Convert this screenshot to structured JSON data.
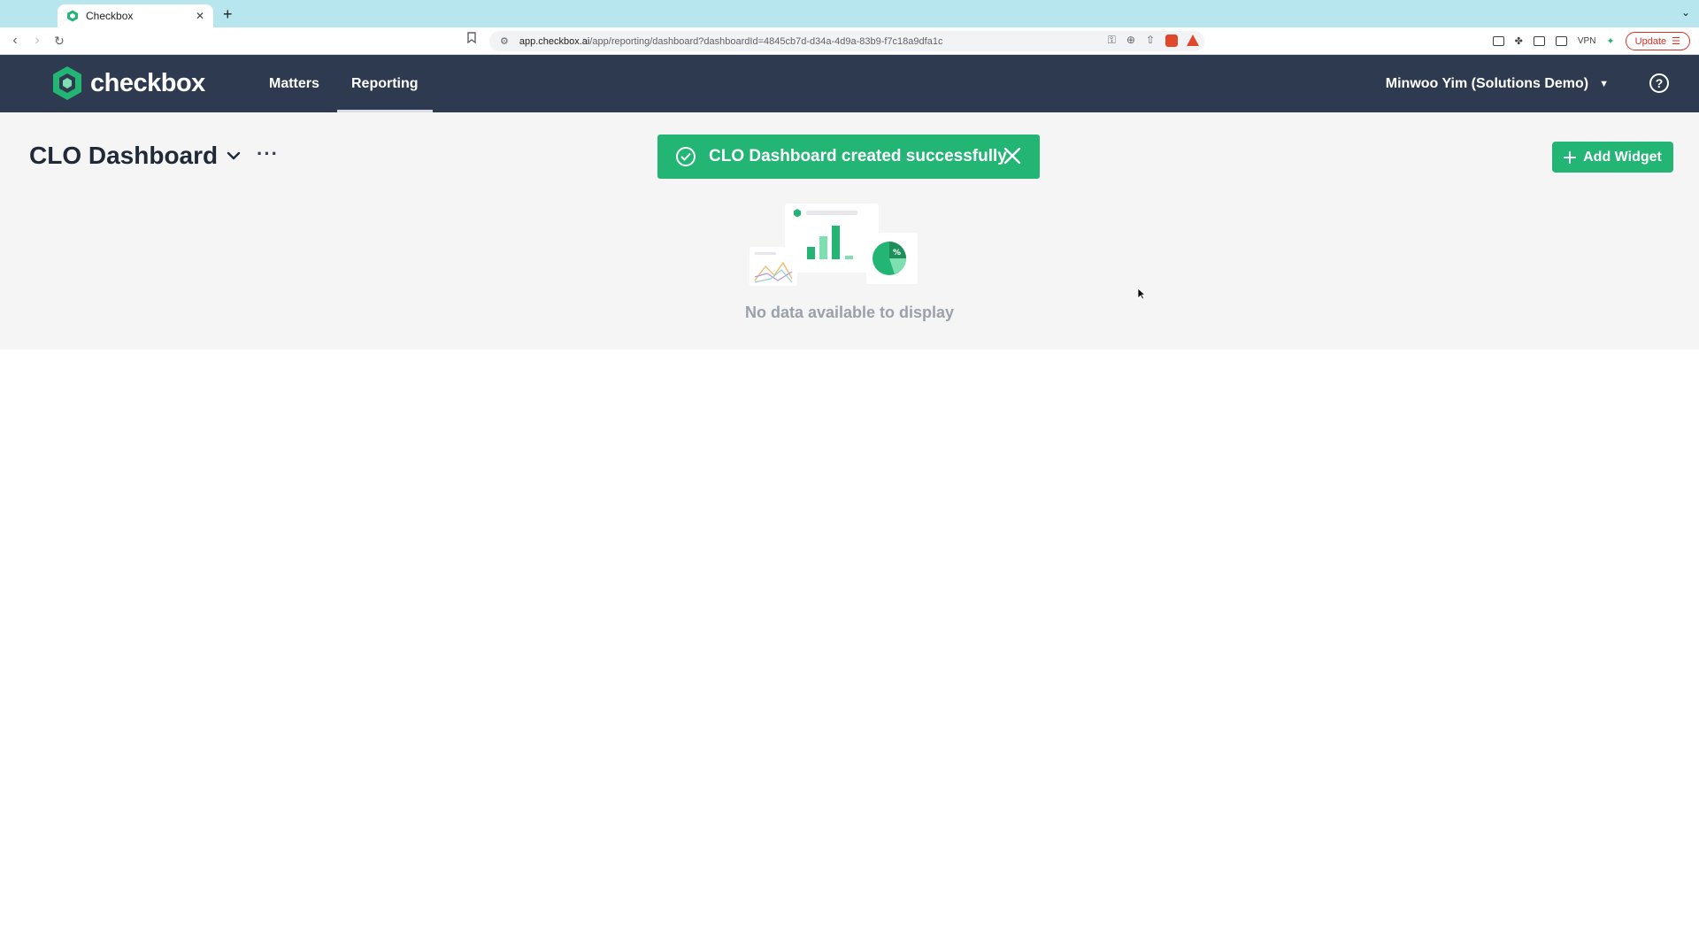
{
  "browser": {
    "tab_title": "Checkbox",
    "url_domain": "app.checkbox.ai",
    "url_path": "/app/reporting/dashboard?dashboardId=4845cb7d-d34a-4d9a-83b9-f7c18a9dfa1c",
    "vpn_label": "VPN",
    "update_label": "Update"
  },
  "app": {
    "logo_text": "checkbox",
    "nav": [
      {
        "label": "Matters"
      },
      {
        "label": "Reporting"
      }
    ],
    "user_name": "Minwoo Yim (Solutions Demo)",
    "help_label": "?"
  },
  "dashboard": {
    "title": "CLO Dashboard",
    "more_label": "···",
    "toast_message": "CLO Dashboard created successfully",
    "add_widget_label": "Add Widget",
    "empty_message": "No data available to display"
  },
  "colors": {
    "header_bg": "#2e3a50",
    "accent_green": "#22b573",
    "content_bg": "#f5f5f5"
  }
}
